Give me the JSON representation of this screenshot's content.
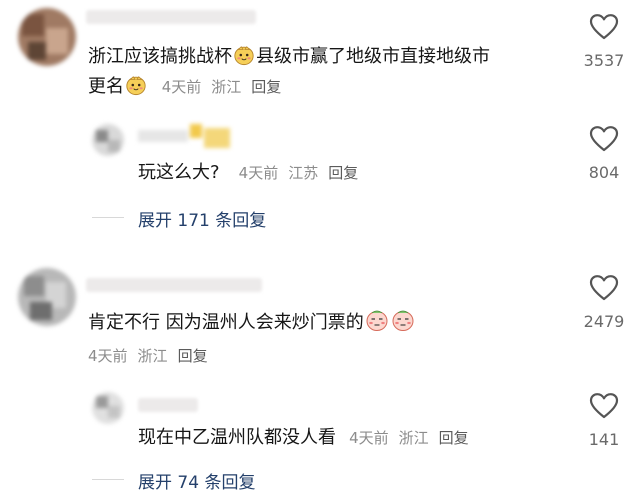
{
  "comments": [
    {
      "text_a": "浙江应该搞挑战杯",
      "text_b": "县级市赢了地级市直接地级市",
      "text_c": "更名",
      "time": "4天前",
      "location": "浙江",
      "reply_label": "回复",
      "likes": "3537",
      "replies": [
        {
          "text": "玩这么大?",
          "time": "4天前",
          "location": "江苏",
          "reply_label": "回复",
          "likes": "804"
        }
      ],
      "expand_label": "展开 171 条回复"
    },
    {
      "text": "肯定不行 因为温州人会来炒门票的",
      "time": "4天前",
      "location": "浙江",
      "reply_label": "回复",
      "likes": "2479",
      "replies": [
        {
          "text": "现在中乙温州队都没人看",
          "time": "4天前",
          "location": "浙江",
          "reply_label": "回复",
          "likes": "141"
        }
      ],
      "expand_label": "展开 74 条回复"
    }
  ],
  "colors": {
    "meta": "#8c8c8c",
    "link": "#24406b",
    "heart": "#555555"
  },
  "icons": {
    "like": "heart-outline-icon",
    "emoji": "smiling-face-emoji"
  }
}
